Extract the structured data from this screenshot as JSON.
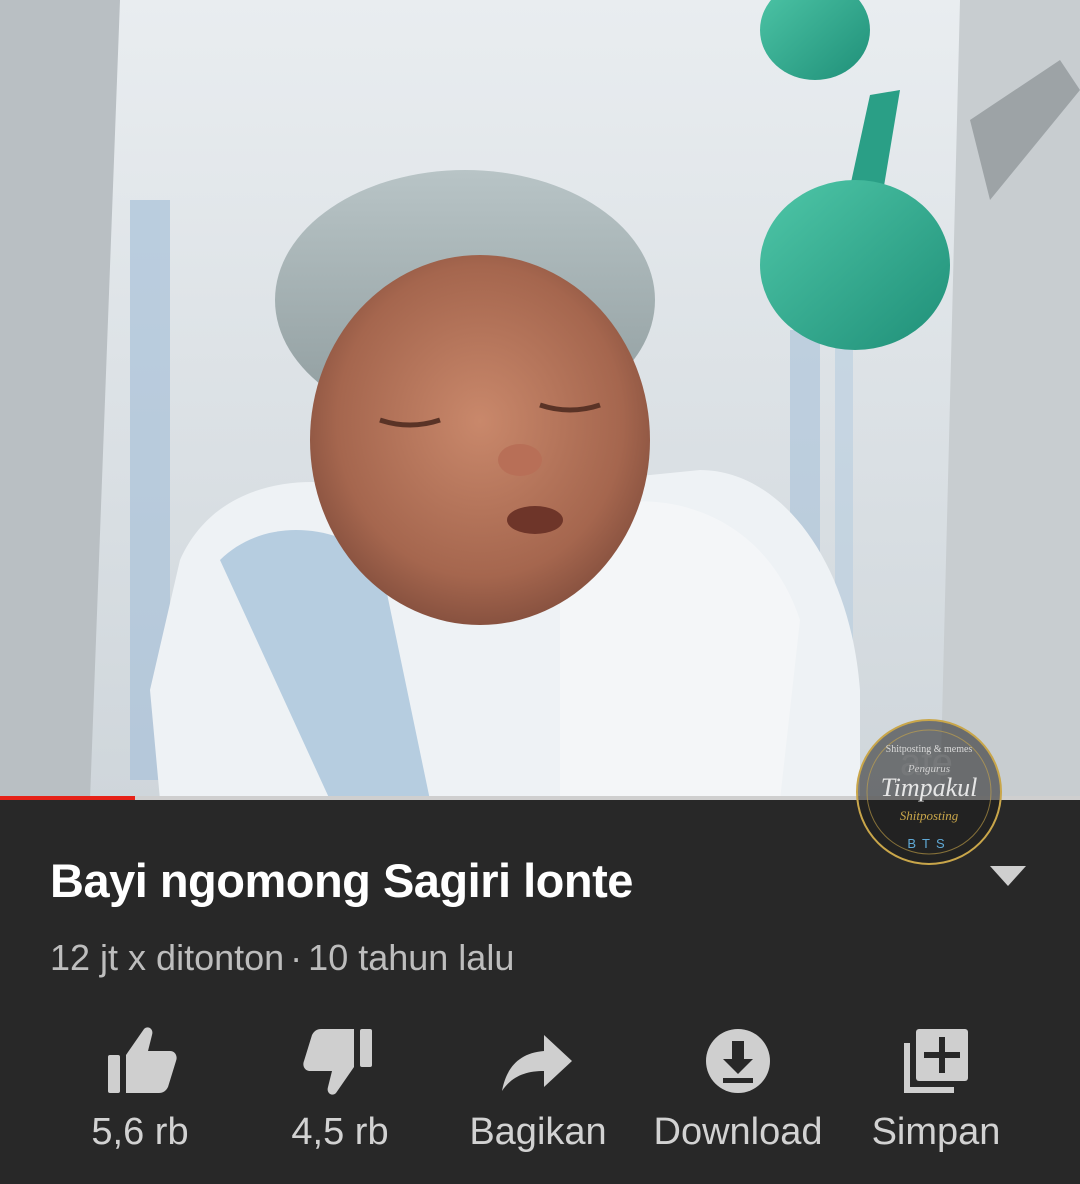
{
  "video": {
    "thumbnail_icon": "newborn-baby-photo",
    "progress": 0.125,
    "watermark_lines": [
      "Shitposting & memes",
      "Pengurus",
      "Timpakul",
      "Shitposting",
      "BTS"
    ]
  },
  "title": "Bayi ngomong Sagiri lonte",
  "meta": {
    "views": "12 jt x ditonton",
    "separator": "·",
    "age": "10 tahun lalu"
  },
  "actions": [
    {
      "icon": "thumbs-up-icon",
      "label": "5,6 rb"
    },
    {
      "icon": "thumbs-down-icon",
      "label": "4,5 rb"
    },
    {
      "icon": "share-icon",
      "label": "Bagikan"
    },
    {
      "icon": "download-icon",
      "label": "Download"
    },
    {
      "icon": "add-to-playlist-icon",
      "label": "Simpan"
    }
  ],
  "colors": {
    "background": "#282828",
    "progress_red": "#e62117",
    "progress_track": "#cfcfcf",
    "icon_gray": "#cfcfcf"
  }
}
